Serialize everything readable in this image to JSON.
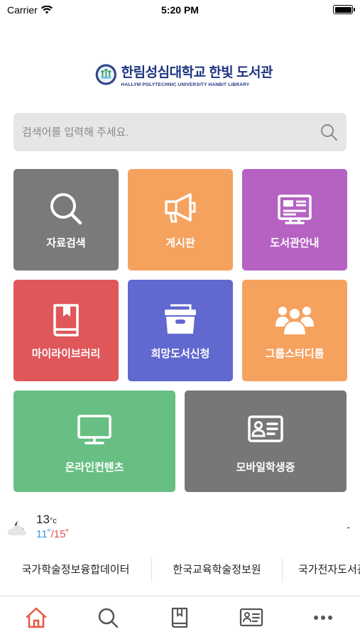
{
  "status_bar": {
    "carrier": "Carrier",
    "time": "5:20 PM",
    "battery_level": 1.0
  },
  "header": {
    "title_kr": "한림성심대학교 한빛 도서관",
    "title_en": "HALLYM POLYTECHNIC UNIVERSITY HANBIT LIBRARY"
  },
  "search": {
    "placeholder": "검색어를 입력해 주세요.",
    "value": ""
  },
  "menu": {
    "tiles": [
      {
        "label": "자료검색",
        "icon": "search-icon",
        "color": "#7a7a7a"
      },
      {
        "label": "게시판",
        "icon": "megaphone-icon",
        "color": "#f6a25f"
      },
      {
        "label": "도서관안내",
        "icon": "info-board-icon",
        "color": "#b562c3"
      },
      {
        "label": "마이라이브러리",
        "icon": "book-icon",
        "color": "#e0575a"
      },
      {
        "label": "희망도서신청",
        "icon": "archive-box-icon",
        "color": "#6168cf"
      },
      {
        "label": "그룹스터디룸",
        "icon": "group-users-icon",
        "color": "#f6a25f"
      },
      {
        "label": "온라인컨텐츠",
        "icon": "monitor-icon",
        "color": "#68bf84"
      },
      {
        "label": "모바일학생증",
        "icon": "id-card-icon",
        "color": "#777777"
      }
    ]
  },
  "weather": {
    "icon": "partly-cloudy-night-icon",
    "temp": "13",
    "unit": "°c",
    "min": "11˚",
    "separator": "/",
    "max": "15˚",
    "right_text": "-"
  },
  "links": [
    {
      "label": "국가학술정보융합데이터"
    },
    {
      "label": "한국교육학술정보원"
    },
    {
      "label": "국가전자도서관"
    }
  ],
  "tabbar": {
    "active_color": "#e8573f",
    "items": [
      {
        "icon": "home-icon",
        "active": true
      },
      {
        "icon": "search-icon",
        "active": false
      },
      {
        "icon": "book-icon",
        "active": false
      },
      {
        "icon": "id-card-icon",
        "active": false
      },
      {
        "icon": "more-icon",
        "active": false
      }
    ]
  }
}
